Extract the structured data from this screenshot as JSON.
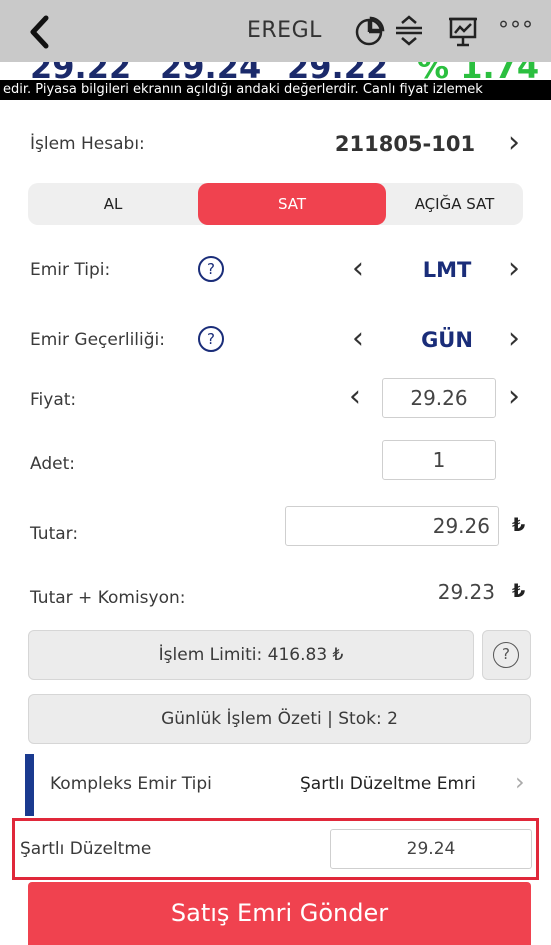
{
  "header": {
    "symbol": "EREGL",
    "more_label": "°°°",
    "prices": [
      "29.22",
      "29.24",
      "29.22",
      "% 1.74"
    ],
    "ticker_text": "edir. Piyasa bilgileri ekranın açıldığı andaki değerlerdir. Canlı fiyat izlemek"
  },
  "account": {
    "label": "İşlem Hesabı:",
    "value": "211805-101"
  },
  "side_tabs": [
    {
      "label": "AL",
      "active": false
    },
    {
      "label": "SAT",
      "active": true
    },
    {
      "label": "AÇIĞA SAT",
      "active": false
    }
  ],
  "order_type": {
    "label": "Emir Tipi:",
    "value": "LMT"
  },
  "validity": {
    "label": "Emir Geçerliliği:",
    "value": "GÜN"
  },
  "price": {
    "label": "Fiyat:",
    "value": "29.26"
  },
  "quantity": {
    "label": "Adet:",
    "value": "1"
  },
  "amount": {
    "label": "Tutar:",
    "value": "29.26",
    "currency": "₺"
  },
  "amount_commission": {
    "label": "Tutar + Komisyon:",
    "value": "29.23",
    "currency": "₺"
  },
  "limit": {
    "label": "İşlem Limiti: 416.83 ₺"
  },
  "daily_summary": {
    "label": "Günlük İşlem Özeti | Stok: 2"
  },
  "complex": {
    "label": "Kompleks Emir Tipi",
    "value": "Şartlı Düzeltme Emri"
  },
  "conditional": {
    "label": "Şartlı Düzeltme",
    "value": "29.24"
  },
  "submit": {
    "label": "Satış Emri Gönder"
  },
  "icons": {
    "help": "?",
    "chevron_left": "‹",
    "chevron_right": "›"
  },
  "colors": {
    "accent_red": "#f0424f",
    "navy": "#1a2d79",
    "green": "#2bbf3f"
  }
}
